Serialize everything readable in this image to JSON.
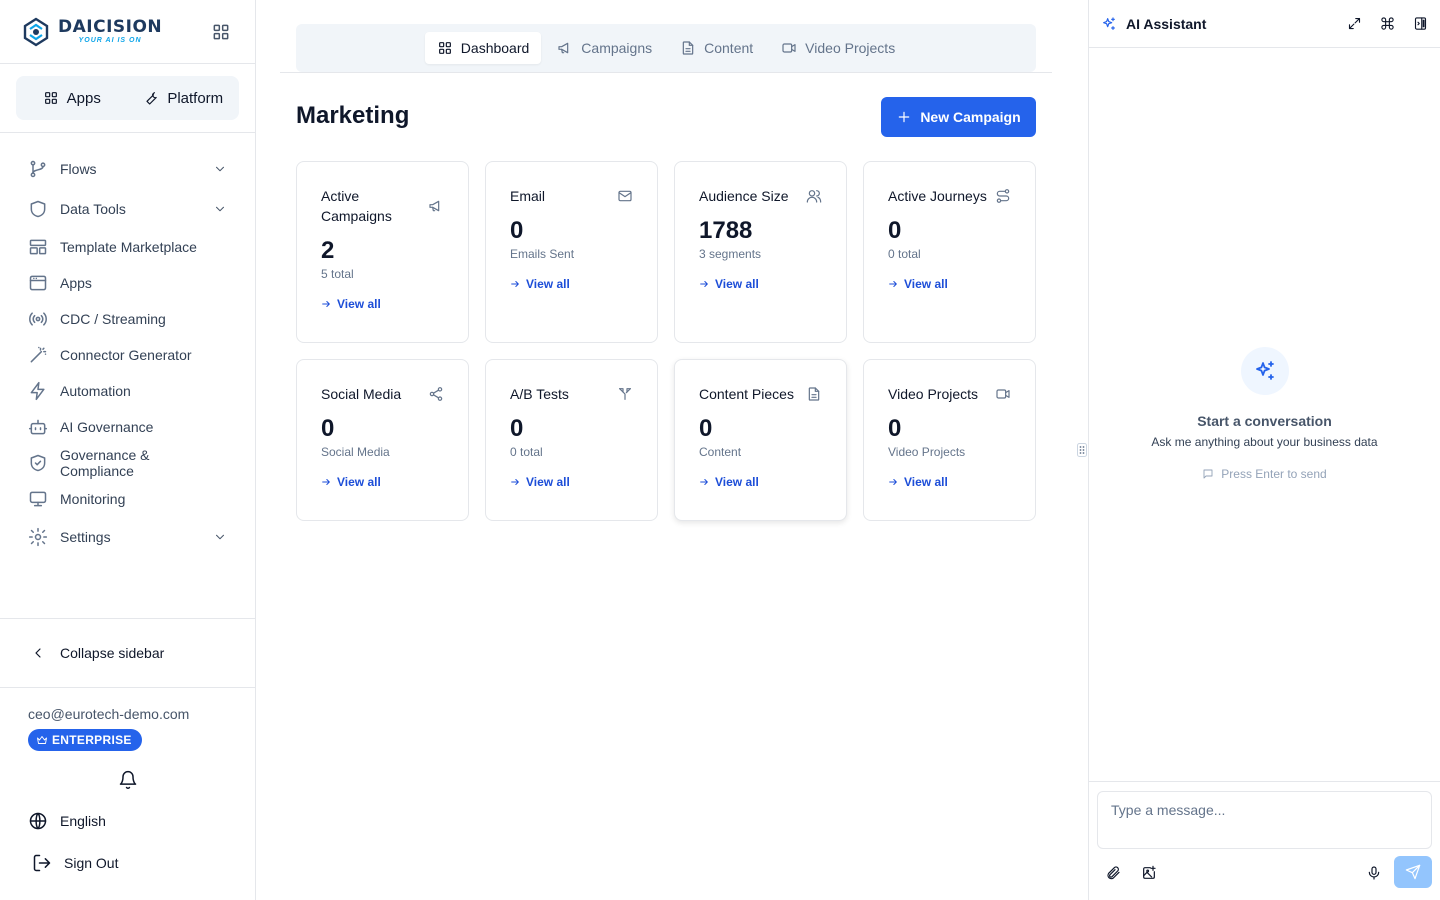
{
  "brand": {
    "name": "DAICISION",
    "tagline": "YOUR AI IS ON"
  },
  "switcher": {
    "apps": "Apps",
    "platform": "Platform"
  },
  "nav": {
    "items": [
      {
        "label": "Flows"
      },
      {
        "label": "Data Tools"
      },
      {
        "label": "Template Marketplace"
      },
      {
        "label": "Apps"
      },
      {
        "label": "CDC / Streaming"
      },
      {
        "label": "Connector Generator"
      },
      {
        "label": "Automation"
      },
      {
        "label": "AI Governance"
      },
      {
        "label": "Governance & Compliance"
      },
      {
        "label": "Monitoring"
      },
      {
        "label": "Settings"
      }
    ]
  },
  "sidebar_footer": {
    "collapse": "Collapse sidebar",
    "email": "ceo@eurotech-demo.com",
    "plan": "ENTERPRISE",
    "language": "English",
    "sign_out": "Sign Out"
  },
  "tabs": [
    {
      "label": "Dashboard",
      "active": true
    },
    {
      "label": "Campaigns"
    },
    {
      "label": "Content"
    },
    {
      "label": "Video Projects"
    }
  ],
  "page": {
    "title": "Marketing",
    "new_button": "New Campaign"
  },
  "cards": [
    {
      "title": "Active Campaigns",
      "value": "2",
      "sub": "5 total",
      "link": "View all",
      "icon": "megaphone-icon"
    },
    {
      "title": "Email",
      "value": "0",
      "sub": "Emails Sent",
      "link": "View all",
      "icon": "mail-icon"
    },
    {
      "title": "Audience Size",
      "value": "1788",
      "sub": "3 segments",
      "link": "View all",
      "icon": "users-icon"
    },
    {
      "title": "Active Journeys",
      "value": "0",
      "sub": "0 total",
      "link": "View all",
      "icon": "route-icon"
    },
    {
      "title": "Social Media",
      "value": "0",
      "sub": "Social Media",
      "link": "View all",
      "icon": "share-icon"
    },
    {
      "title": "A/B Tests",
      "value": "0",
      "sub": "0 total",
      "link": "View all",
      "icon": "split-icon"
    },
    {
      "title": "Content Pieces",
      "value": "0",
      "sub": "Content",
      "link": "View all",
      "icon": "document-icon"
    },
    {
      "title": "Video Projects",
      "value": "0",
      "sub": "Video Projects",
      "link": "View all",
      "icon": "video-icon"
    }
  ],
  "assistant": {
    "title": "AI Assistant",
    "empty_title": "Start a conversation",
    "empty_sub": "Ask me anything about your business data",
    "hint": "Press Enter to send",
    "input_placeholder": "Type a message..."
  },
  "colors": {
    "primary": "#2563eb",
    "send_disabled": "#93c5fd",
    "link": "#1d4ed8"
  }
}
